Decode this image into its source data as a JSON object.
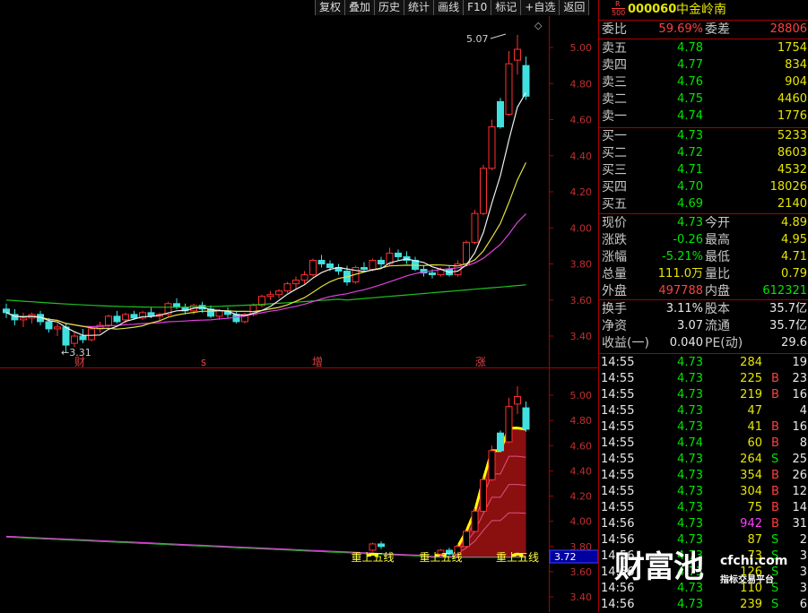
{
  "toolbar": [
    "复权",
    "叠加",
    "历史",
    "统计",
    "画线",
    "F10",
    "标记",
    "+自选",
    "返回"
  ],
  "stock": {
    "badge_top": "R",
    "badge_bottom": "500",
    "code": "000060",
    "name": "中金岭南"
  },
  "weibi": {
    "label1": "委比",
    "value1": "59.69%",
    "label2": "委差",
    "value2": "28806"
  },
  "asks": [
    {
      "label": "卖五",
      "price": "4.78",
      "vol": "1754"
    },
    {
      "label": "卖四",
      "price": "4.77",
      "vol": "834"
    },
    {
      "label": "卖三",
      "price": "4.76",
      "vol": "904"
    },
    {
      "label": "卖二",
      "price": "4.75",
      "vol": "4460"
    },
    {
      "label": "卖一",
      "price": "4.74",
      "vol": "1776"
    }
  ],
  "bids": [
    {
      "label": "买一",
      "price": "4.73",
      "vol": "5233"
    },
    {
      "label": "买二",
      "price": "4.72",
      "vol": "8603"
    },
    {
      "label": "买三",
      "price": "4.71",
      "vol": "4532"
    },
    {
      "label": "买四",
      "price": "4.70",
      "vol": "18026"
    },
    {
      "label": "买五",
      "price": "4.69",
      "vol": "2140"
    }
  ],
  "stats1": [
    {
      "l1": "现价",
      "v1": "4.73",
      "l2": "今开",
      "v2": "4.89"
    },
    {
      "l1": "涨跌",
      "v1": "-0.26",
      "l2": "最高",
      "v2": "4.95"
    },
    {
      "l1": "涨幅",
      "v1": "-5.21%",
      "l2": "最低",
      "v2": "4.71"
    },
    {
      "l1": "总量",
      "v1": "111.0万",
      "l2": "量比",
      "v2": "0.79"
    },
    {
      "l1": "外盘",
      "v1": "497788",
      "l2": "内盘",
      "v2": "612321"
    }
  ],
  "stats2": [
    {
      "l1": "换手",
      "v1": "3.11%",
      "l2": "股本",
      "v2": "35.7亿"
    },
    {
      "l1": "净资",
      "v1": "3.07",
      "l2": "流通",
      "v2": "35.7亿"
    },
    {
      "l1": "收益(一)",
      "v1": "0.040",
      "l2": "PE(动)",
      "v2": "29.6"
    }
  ],
  "ticks": [
    {
      "t": "14:55",
      "p": "4.73",
      "v": "284",
      "s": "",
      "n": "19",
      "vc": "ylw"
    },
    {
      "t": "14:55",
      "p": "4.73",
      "v": "225",
      "s": "B",
      "n": "23",
      "vc": "ylw"
    },
    {
      "t": "14:55",
      "p": "4.73",
      "v": "219",
      "s": "B",
      "n": "16",
      "vc": "ylw"
    },
    {
      "t": "14:55",
      "p": "4.73",
      "v": "47",
      "s": "",
      "n": "4",
      "vc": "ylw"
    },
    {
      "t": "14:55",
      "p": "4.73",
      "v": "41",
      "s": "B",
      "n": "16",
      "vc": "ylw"
    },
    {
      "t": "14:55",
      "p": "4.74",
      "v": "60",
      "s": "B",
      "n": "8",
      "vc": "ylw"
    },
    {
      "t": "14:55",
      "p": "4.73",
      "v": "264",
      "s": "S",
      "n": "25",
      "vc": "ylw"
    },
    {
      "t": "14:55",
      "p": "4.73",
      "v": "354",
      "s": "B",
      "n": "26",
      "vc": "ylw"
    },
    {
      "t": "14:55",
      "p": "4.73",
      "v": "304",
      "s": "B",
      "n": "12",
      "vc": "ylw"
    },
    {
      "t": "14:55",
      "p": "4.73",
      "v": "75",
      "s": "B",
      "n": "14",
      "vc": "ylw"
    },
    {
      "t": "14:56",
      "p": "4.73",
      "v": "942",
      "s": "B",
      "n": "31",
      "vc": "mag"
    },
    {
      "t": "14:56",
      "p": "4.73",
      "v": "87",
      "s": "S",
      "n": "2",
      "vc": "ylw"
    },
    {
      "t": "14:56",
      "p": "4.73",
      "v": "73",
      "s": "S",
      "n": "3",
      "vc": "ylw"
    },
    {
      "t": "14:56",
      "p": "4.73",
      "v": "126",
      "s": "S",
      "n": "3",
      "vc": "ylw"
    },
    {
      "t": "14:56",
      "p": "4.73",
      "v": "110",
      "s": "S",
      "n": "3",
      "vc": "ylw"
    },
    {
      "t": "14:56",
      "p": "4.73",
      "v": "239",
      "s": "S",
      "n": "6",
      "vc": "ylw"
    }
  ],
  "chart_data": [
    {
      "type": "candlestick",
      "title": "",
      "y_ticks": [
        "5.00",
        "4.80",
        "4.60",
        "4.40",
        "4.20",
        "4.00",
        "3.80",
        "3.60",
        "3.40"
      ],
      "ylim": [
        3.3,
        5.1
      ],
      "annotations": {
        "high": "5.07",
        "low": "3.31"
      },
      "markers": [
        "财",
        "s",
        "增",
        "涨"
      ],
      "candles": [
        [
          3.55,
          3.58,
          3.5,
          3.53
        ],
        [
          3.52,
          3.55,
          3.46,
          3.49
        ],
        [
          3.49,
          3.53,
          3.45,
          3.5
        ],
        [
          3.5,
          3.53,
          3.47,
          3.52
        ],
        [
          3.52,
          3.54,
          3.46,
          3.48
        ],
        [
          3.48,
          3.5,
          3.42,
          3.44
        ],
        [
          3.44,
          3.47,
          3.4,
          3.45
        ],
        [
          3.45,
          3.47,
          3.31,
          3.35
        ],
        [
          3.36,
          3.42,
          3.34,
          3.4
        ],
        [
          3.4,
          3.44,
          3.36,
          3.38
        ],
        [
          3.38,
          3.45,
          3.37,
          3.44
        ],
        [
          3.44,
          3.48,
          3.42,
          3.46
        ],
        [
          3.46,
          3.52,
          3.45,
          3.51
        ],
        [
          3.51,
          3.54,
          3.47,
          3.48
        ],
        [
          3.49,
          3.53,
          3.47,
          3.52
        ],
        [
          3.52,
          3.54,
          3.49,
          3.5
        ],
        [
          3.5,
          3.54,
          3.49,
          3.53
        ],
        [
          3.53,
          3.56,
          3.5,
          3.51
        ],
        [
          3.51,
          3.53,
          3.48,
          3.52
        ],
        [
          3.52,
          3.59,
          3.51,
          3.58
        ],
        [
          3.58,
          3.61,
          3.55,
          3.56
        ],
        [
          3.56,
          3.58,
          3.52,
          3.54
        ],
        [
          3.54,
          3.58,
          3.52,
          3.57
        ],
        [
          3.57,
          3.59,
          3.53,
          3.55
        ],
        [
          3.55,
          3.57,
          3.5,
          3.51
        ],
        [
          3.51,
          3.55,
          3.49,
          3.54
        ],
        [
          3.54,
          3.56,
          3.5,
          3.52
        ],
        [
          3.52,
          3.54,
          3.47,
          3.48
        ],
        [
          3.48,
          3.53,
          3.47,
          3.52
        ],
        [
          3.52,
          3.58,
          3.51,
          3.57
        ],
        [
          3.57,
          3.63,
          3.56,
          3.62
        ],
        [
          3.62,
          3.65,
          3.6,
          3.63
        ],
        [
          3.63,
          3.66,
          3.61,
          3.65
        ],
        [
          3.65,
          3.7,
          3.64,
          3.69
        ],
        [
          3.69,
          3.73,
          3.66,
          3.71
        ],
        [
          3.71,
          3.76,
          3.69,
          3.74
        ],
        [
          3.74,
          3.83,
          3.73,
          3.82
        ],
        [
          3.82,
          3.85,
          3.78,
          3.8
        ],
        [
          3.8,
          3.82,
          3.76,
          3.78
        ],
        [
          3.78,
          3.8,
          3.74,
          3.76
        ],
        [
          3.76,
          3.79,
          3.68,
          3.7
        ],
        [
          3.7,
          3.79,
          3.69,
          3.78
        ],
        [
          3.78,
          3.81,
          3.76,
          3.77
        ],
        [
          3.77,
          3.83,
          3.76,
          3.82
        ],
        [
          3.82,
          3.84,
          3.78,
          3.8
        ],
        [
          3.8,
          3.89,
          3.79,
          3.86
        ],
        [
          3.86,
          3.88,
          3.82,
          3.84
        ],
        [
          3.84,
          3.87,
          3.8,
          3.82
        ],
        [
          3.82,
          3.84,
          3.76,
          3.77
        ],
        [
          3.77,
          3.79,
          3.73,
          3.75
        ],
        [
          3.75,
          3.77,
          3.72,
          3.74
        ],
        [
          3.74,
          3.78,
          3.73,
          3.77
        ],
        [
          3.77,
          3.79,
          3.73,
          3.74
        ],
        [
          3.74,
          3.82,
          3.73,
          3.8
        ],
        [
          3.8,
          3.93,
          3.79,
          3.92
        ],
        [
          3.92,
          4.1,
          3.91,
          4.08
        ],
        [
          4.08,
          4.35,
          4.07,
          4.33
        ],
        [
          4.33,
          4.6,
          4.32,
          4.56
        ],
        [
          4.7,
          4.72,
          4.55,
          4.56
        ],
        [
          4.63,
          4.98,
          4.62,
          4.91
        ],
        [
          4.93,
          5.07,
          4.85,
          4.99
        ],
        [
          4.9,
          4.95,
          4.71,
          4.73
        ]
      ]
    },
    {
      "type": "indicator",
      "title": "",
      "y_ticks": [
        "5.00",
        "4.80",
        "4.60",
        "4.40",
        "4.20",
        "4.00",
        "3.80",
        "3.60",
        "3.40"
      ],
      "current_value": "3.72",
      "signal_label": "重上五线",
      "signal_indices": [
        43,
        51,
        60
      ]
    }
  ],
  "watermark": {
    "main": "财富池",
    "domain": "cfchi.com",
    "sub": "指标交易平台"
  }
}
